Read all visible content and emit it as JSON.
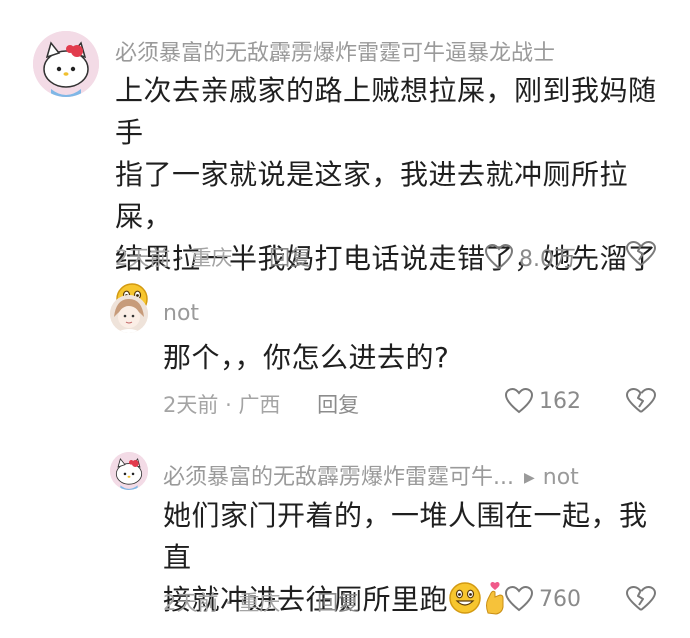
{
  "comments": [
    {
      "username": "必须暴富的无敌霹雳爆炸雷霆可牛逼暴龙战士",
      "lines": [
        "上次去亲戚家的路上贼想拉屎，刚到我妈随手",
        "指了一家就说是这家，我进去就冲厕所拉屎，",
        "结果拉一半我妈打电话说走错了，她先溜了"
      ],
      "emoji": "grinning-face-emoji",
      "time": "2天前",
      "location": "重庆",
      "reply_label": "回复",
      "likes": "8.0万",
      "avatar": "hello-kitty-avatar"
    },
    {
      "username": "not",
      "lines": [
        "那个，，你怎么进去的?"
      ],
      "time": "2天前",
      "location": "广西",
      "reply_label": "回复",
      "likes": "162",
      "avatar": "girl-avatar"
    },
    {
      "username": "必须暴富的无敌霹雳爆炸雷霆可牛...",
      "reply_to": "not",
      "lines": [
        "她们家门开着的，一堆人围在一起，我直",
        "接就冲进去往厕所里跑"
      ],
      "emojis": [
        "grinning-face-emoji",
        "finger-heart-emoji"
      ],
      "time": "2天前",
      "location": "重庆",
      "reply_label": "回复",
      "likes": "760",
      "avatar": "hello-kitty-avatar"
    }
  ],
  "separator": "·",
  "colors": {
    "text": "#1f1f1f",
    "muted": "#9a9a9a",
    "icon": "#8a8a8a"
  }
}
